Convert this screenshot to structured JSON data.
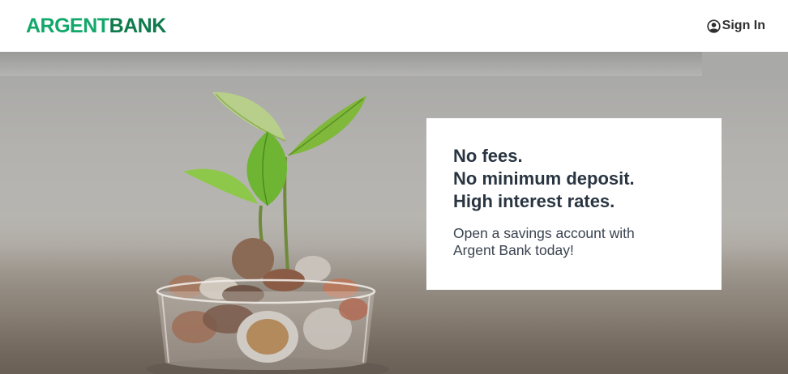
{
  "header": {
    "logo_part1": "ARGENT",
    "logo_part2": "BANK",
    "signin_label": "Sign In",
    "signin_icon": "user-circle-icon"
  },
  "hero": {
    "image": "plant-sprout-in-glass-of-coins",
    "headline": [
      "No fees.",
      "No minimum deposit.",
      "High interest rates."
    ],
    "subtext": "Open a savings account with Argent Bank today!"
  },
  "colors": {
    "brand_green": "#13a86a",
    "brand_green_dark": "#0f7a4c",
    "headline_text": "#2a3542"
  }
}
